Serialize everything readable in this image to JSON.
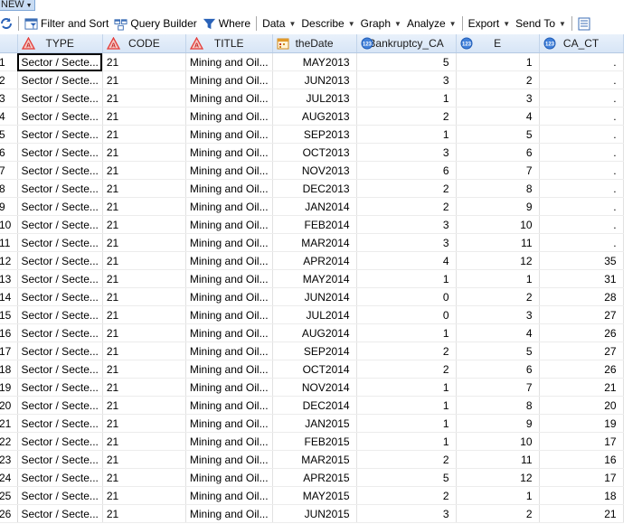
{
  "new_button": {
    "label": "NEW"
  },
  "toolbar": {
    "filter_sort": "Filter and Sort",
    "query_builder": "Query Builder",
    "where": "Where",
    "data": "Data",
    "describe": "Describe",
    "graph": "Graph",
    "analyze": "Analyze",
    "export": "Export",
    "send_to": "Send To"
  },
  "columns": [
    {
      "label": "TYPE",
      "icon": "character-warning-icon"
    },
    {
      "label": "CODE",
      "icon": "character-warning-icon"
    },
    {
      "label": "TITLE",
      "icon": "character-warning-icon"
    },
    {
      "label": "theDate",
      "icon": "calendar-icon"
    },
    {
      "label": "Bankruptcy_CA",
      "icon": "numeric-icon"
    },
    {
      "label": "E",
      "icon": "numeric-icon"
    },
    {
      "label": "CA_CT",
      "icon": "numeric-icon"
    }
  ],
  "rows": [
    {
      "n": "1",
      "type": "Sector / Secte...",
      "code": "21",
      "title": "Mining and Oil...",
      "date": "MAY2013",
      "bca": "5",
      "e": "1",
      "ca": "."
    },
    {
      "n": "2",
      "type": "Sector / Secte...",
      "code": "21",
      "title": "Mining and Oil...",
      "date": "JUN2013",
      "bca": "3",
      "e": "2",
      "ca": "."
    },
    {
      "n": "3",
      "type": "Sector / Secte...",
      "code": "21",
      "title": "Mining and Oil...",
      "date": "JUL2013",
      "bca": "1",
      "e": "3",
      "ca": "."
    },
    {
      "n": "4",
      "type": "Sector / Secte...",
      "code": "21",
      "title": "Mining and Oil...",
      "date": "AUG2013",
      "bca": "2",
      "e": "4",
      "ca": "."
    },
    {
      "n": "5",
      "type": "Sector / Secte...",
      "code": "21",
      "title": "Mining and Oil...",
      "date": "SEP2013",
      "bca": "1",
      "e": "5",
      "ca": "."
    },
    {
      "n": "6",
      "type": "Sector / Secte...",
      "code": "21",
      "title": "Mining and Oil...",
      "date": "OCT2013",
      "bca": "3",
      "e": "6",
      "ca": "."
    },
    {
      "n": "7",
      "type": "Sector / Secte...",
      "code": "21",
      "title": "Mining and Oil...",
      "date": "NOV2013",
      "bca": "6",
      "e": "7",
      "ca": "."
    },
    {
      "n": "8",
      "type": "Sector / Secte...",
      "code": "21",
      "title": "Mining and Oil...",
      "date": "DEC2013",
      "bca": "2",
      "e": "8",
      "ca": "."
    },
    {
      "n": "9",
      "type": "Sector / Secte...",
      "code": "21",
      "title": "Mining and Oil...",
      "date": "JAN2014",
      "bca": "2",
      "e": "9",
      "ca": "."
    },
    {
      "n": "10",
      "type": "Sector / Secte...",
      "code": "21",
      "title": "Mining and Oil...",
      "date": "FEB2014",
      "bca": "3",
      "e": "10",
      "ca": "."
    },
    {
      "n": "11",
      "type": "Sector / Secte...",
      "code": "21",
      "title": "Mining and Oil...",
      "date": "MAR2014",
      "bca": "3",
      "e": "11",
      "ca": "."
    },
    {
      "n": "12",
      "type": "Sector / Secte...",
      "code": "21",
      "title": "Mining and Oil...",
      "date": "APR2014",
      "bca": "4",
      "e": "12",
      "ca": "35"
    },
    {
      "n": "13",
      "type": "Sector / Secte...",
      "code": "21",
      "title": "Mining and Oil...",
      "date": "MAY2014",
      "bca": "1",
      "e": "1",
      "ca": "31"
    },
    {
      "n": "14",
      "type": "Sector / Secte...",
      "code": "21",
      "title": "Mining and Oil...",
      "date": "JUN2014",
      "bca": "0",
      "e": "2",
      "ca": "28"
    },
    {
      "n": "15",
      "type": "Sector / Secte...",
      "code": "21",
      "title": "Mining and Oil...",
      "date": "JUL2014",
      "bca": "0",
      "e": "3",
      "ca": "27"
    },
    {
      "n": "16",
      "type": "Sector / Secte...",
      "code": "21",
      "title": "Mining and Oil...",
      "date": "AUG2014",
      "bca": "1",
      "e": "4",
      "ca": "26"
    },
    {
      "n": "17",
      "type": "Sector / Secte...",
      "code": "21",
      "title": "Mining and Oil...",
      "date": "SEP2014",
      "bca": "2",
      "e": "5",
      "ca": "27"
    },
    {
      "n": "18",
      "type": "Sector / Secte...",
      "code": "21",
      "title": "Mining and Oil...",
      "date": "OCT2014",
      "bca": "2",
      "e": "6",
      "ca": "26"
    },
    {
      "n": "19",
      "type": "Sector / Secte...",
      "code": "21",
      "title": "Mining and Oil...",
      "date": "NOV2014",
      "bca": "1",
      "e": "7",
      "ca": "21"
    },
    {
      "n": "20",
      "type": "Sector / Secte...",
      "code": "21",
      "title": "Mining and Oil...",
      "date": "DEC2014",
      "bca": "1",
      "e": "8",
      "ca": "20"
    },
    {
      "n": "21",
      "type": "Sector / Secte...",
      "code": "21",
      "title": "Mining and Oil...",
      "date": "JAN2015",
      "bca": "1",
      "e": "9",
      "ca": "19"
    },
    {
      "n": "22",
      "type": "Sector / Secte...",
      "code": "21",
      "title": "Mining and Oil...",
      "date": "FEB2015",
      "bca": "1",
      "e": "10",
      "ca": "17"
    },
    {
      "n": "23",
      "type": "Sector / Secte...",
      "code": "21",
      "title": "Mining and Oil...",
      "date": "MAR2015",
      "bca": "2",
      "e": "11",
      "ca": "16"
    },
    {
      "n": "24",
      "type": "Sector / Secte...",
      "code": "21",
      "title": "Mining and Oil...",
      "date": "APR2015",
      "bca": "5",
      "e": "12",
      "ca": "17"
    },
    {
      "n": "25",
      "type": "Sector / Secte...",
      "code": "21",
      "title": "Mining and Oil...",
      "date": "MAY2015",
      "bca": "2",
      "e": "1",
      "ca": "18"
    },
    {
      "n": "26",
      "type": "Sector / Secte...",
      "code": "21",
      "title": "Mining and Oil...",
      "date": "JUN2015",
      "bca": "3",
      "e": "2",
      "ca": "21"
    }
  ],
  "colors": {
    "header_bg": "#dbe7f7",
    "warning": "#e53935",
    "numeric": "#2f6fd0",
    "accent": "#7ea6d6"
  }
}
